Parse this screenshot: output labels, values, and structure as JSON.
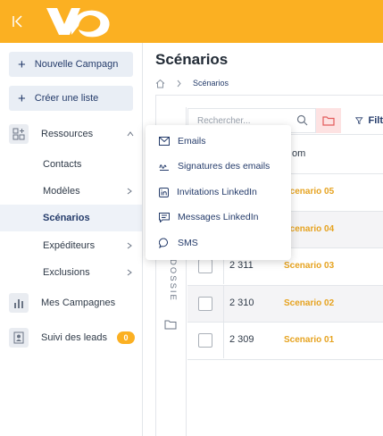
{
  "sidebar": {
    "new_campaign": "Nouvelle Campagn",
    "create_list": "Créer une liste",
    "resources": "Ressources",
    "sub_items": [
      "Contacts",
      "Modèles",
      "Scénarios",
      "Expéditeurs",
      "Exclusions"
    ],
    "my_campaigns": "Mes Campagnes",
    "lead_tracking": "Suivi des leads",
    "lead_count": "0"
  },
  "main": {
    "title": "Scénarios",
    "breadcrumb": "Scénarios",
    "search_placeholder": "Rechercher...",
    "filter_label": "Filt",
    "name_header": "om",
    "folder_label": "DOSSIE"
  },
  "table": {
    "rows": [
      {
        "id": "",
        "name": "Scenario 05"
      },
      {
        "id": "",
        "name": "Scenario 04"
      },
      {
        "id": "2 311",
        "name": "Scenario 03"
      },
      {
        "id": "2 310",
        "name": "Scenario 02"
      },
      {
        "id": "2 309",
        "name": "Scenario 01"
      }
    ]
  },
  "menu": {
    "items": [
      {
        "label": "Emails",
        "icon": "envelope-icon"
      },
      {
        "label": "Signatures des emails",
        "icon": "signature-icon"
      },
      {
        "label": "Invitations LinkedIn",
        "icon": "linkedin-icon"
      },
      {
        "label": "Messages LinkedIn",
        "icon": "message-icon"
      },
      {
        "label": "SMS",
        "icon": "chat-bubble-icon"
      }
    ]
  },
  "colors": {
    "brand": "#fbb022",
    "nav": "#243b6a",
    "link": "#e6a320"
  }
}
